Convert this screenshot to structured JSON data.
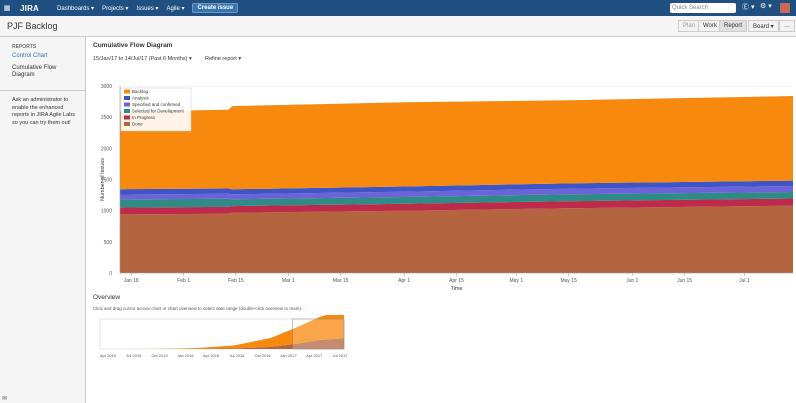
{
  "topbar": {
    "apps_icon": "grid-icon",
    "logo": "JIRA",
    "nav": [
      "Dashboards ▾",
      "Projects ▾",
      "Issues ▾",
      "Agile ▾"
    ],
    "create_label": "Create issue",
    "search_placeholder": "Quick Search",
    "help_icon": "Ⓔ ▾",
    "settings_icon": "⚙ ▾"
  },
  "header": {
    "title": "PJF Backlog",
    "buttons": [
      "Plan",
      "Work",
      "Report",
      "Board ▾"
    ],
    "more": "…"
  },
  "sidebar": {
    "heading": "REPORTS",
    "items": [
      "Control Chart",
      "Cumulative Flow Diagram"
    ],
    "note": "Ask an administrator to enable the enhanced reports in JIRA Agile Labs so you can try them out!"
  },
  "main": {
    "title": "Cumulative Flow Diagram",
    "date_range": "15/Jan/17 to 14/Jul/17 (Past 6 Months) ▾",
    "refine": "Refine report ▾",
    "overview_title": "Overview",
    "overview_help": "Click and drag cursor across chart or chart overview to select date range (double-click overview to reset)."
  },
  "chart_data": [
    {
      "type": "area",
      "title": "",
      "xlabel": "Time",
      "ylabel": "Number of Issues",
      "ylim": [
        0,
        3000
      ],
      "yticks": [
        0,
        500,
        1000,
        1500,
        2000,
        2500,
        3000
      ],
      "xticks": [
        "Jan 18",
        "Feb 1",
        "Feb 15",
        "Mar 1",
        "Mar 15",
        "Apr 1",
        "Apr 15",
        "May 1",
        "May 15",
        "Jun 1",
        "Jun 15",
        "Jul 1"
      ],
      "x": [
        "Jan 15",
        "Feb 13",
        "Feb 14",
        "Apr 1",
        "May 15",
        "Jul 14"
      ],
      "legend_position": "top-left",
      "series": [
        {
          "name": "Done",
          "color": "#b4643f",
          "values": [
            940,
            950,
            965,
            1000,
            1040,
            1080
          ]
        },
        {
          "name": "In Progress",
          "color": "#bd2a4a",
          "values": [
            110,
            110,
            108,
            110,
            112,
            115
          ]
        },
        {
          "name": "Selected for Development",
          "color": "#2e8b86",
          "values": [
            130,
            130,
            110,
            110,
            110,
            105
          ]
        },
        {
          "name": "Specified and confirmed",
          "color": "#6c63d9",
          "values": [
            80,
            80,
            80,
            85,
            90,
            95
          ]
        },
        {
          "name": "Analysis",
          "color": "#3d55c7",
          "values": [
            85,
            85,
            80,
            82,
            85,
            88
          ]
        },
        {
          "name": "Backlog",
          "color": "#f7890f",
          "values": [
            1245,
            1265,
            1335,
            1353,
            1333,
            1357
          ]
        }
      ]
    },
    {
      "type": "area",
      "title": "",
      "xticks": [
        "Apr 2015",
        "Jul 2015",
        "Oct 2015",
        "Jan 2016",
        "Apr 2016",
        "Jul 2016",
        "Oct 2016",
        "Jan 2017",
        "Apr 2017",
        "Jul 2017"
      ],
      "x": [
        0,
        0.25,
        0.4,
        0.55,
        0.7,
        0.8,
        0.9,
        1.0
      ],
      "series": [
        {
          "name": "Done",
          "color": "#b4643f",
          "values": [
            0,
            5,
            20,
            60,
            200,
            500,
            900,
            1080
          ]
        },
        {
          "name": "Backlog",
          "color": "#f7890f",
          "values": [
            0,
            10,
            80,
            300,
            900,
            1600,
            2300,
            2840
          ]
        }
      ]
    }
  ]
}
